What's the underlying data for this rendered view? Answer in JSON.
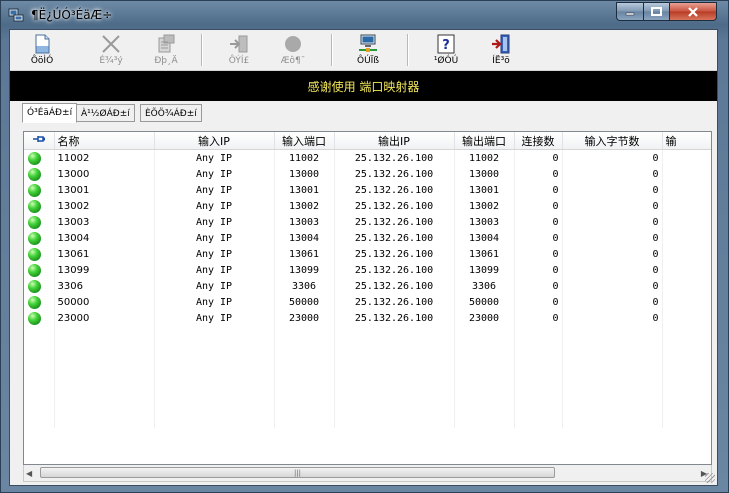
{
  "window": {
    "title": "¶Ë¿ÚÓ³ÉäÆ÷",
    "banner": "感谢使用 端口映射器"
  },
  "toolbar": [
    {
      "label": "ÔöÌÓ",
      "icon": "new-document-icon",
      "enabled": true
    },
    {
      "label": "É¾³ý",
      "icon": "delete-x-icon",
      "enabled": false
    },
    {
      "label": "Ðþ¸Ä",
      "icon": "edit-icon",
      "enabled": false
    },
    {
      "label": "ÔÝÍ£",
      "icon": "pause-icon",
      "enabled": false
    },
    {
      "label": "Æô¶¯",
      "icon": "start-circle-icon",
      "enabled": false
    },
    {
      "label": "ÔÚÏß",
      "icon": "network-computer-icon",
      "enabled": true
    },
    {
      "label": "¹ØÓÚ",
      "icon": "help-question-icon",
      "enabled": true
    },
    {
      "label": "ÍË³ö",
      "icon": "exit-door-icon",
      "enabled": true
    }
  ],
  "tabs": [
    {
      "label": "Ó³ÉäÁÐ±í",
      "active": true
    },
    {
      "label": "À¹½ØÁÐ±í",
      "active": false
    },
    {
      "label": "ÈÕÖ¾ÁÐ±í",
      "active": false
    }
  ],
  "table": {
    "columns": {
      "name": "名称",
      "in_ip": "输入IP",
      "in_port": "输入端口",
      "out_ip": "输出IP",
      "out_port": "输出端口",
      "connections": "连接数",
      "bytes_in": "输入字节数",
      "bytes_out": "输"
    },
    "rows": [
      {
        "name": "11002",
        "in_ip": "Any IP",
        "in_port": "11002",
        "out_ip": "25.132.26.100",
        "out_port": "11002",
        "connections": "0",
        "bytes_in": "0"
      },
      {
        "name": "13000",
        "in_ip": "Any IP",
        "in_port": "13000",
        "out_ip": "25.132.26.100",
        "out_port": "13000",
        "connections": "0",
        "bytes_in": "0"
      },
      {
        "name": "13001",
        "in_ip": "Any IP",
        "in_port": "13001",
        "out_ip": "25.132.26.100",
        "out_port": "13001",
        "connections": "0",
        "bytes_in": "0"
      },
      {
        "name": "13002",
        "in_ip": "Any IP",
        "in_port": "13002",
        "out_ip": "25.132.26.100",
        "out_port": "13002",
        "connections": "0",
        "bytes_in": "0"
      },
      {
        "name": "13003",
        "in_ip": "Any IP",
        "in_port": "13003",
        "out_ip": "25.132.26.100",
        "out_port": "13003",
        "connections": "0",
        "bytes_in": "0"
      },
      {
        "name": "13004",
        "in_ip": "Any IP",
        "in_port": "13004",
        "out_ip": "25.132.26.100",
        "out_port": "13004",
        "connections": "0",
        "bytes_in": "0"
      },
      {
        "name": "13061",
        "in_ip": "Any IP",
        "in_port": "13061",
        "out_ip": "25.132.26.100",
        "out_port": "13061",
        "connections": "0",
        "bytes_in": "0"
      },
      {
        "name": "13099",
        "in_ip": "Any IP",
        "in_port": "13099",
        "out_ip": "25.132.26.100",
        "out_port": "13099",
        "connections": "0",
        "bytes_in": "0"
      },
      {
        "name": "3306",
        "in_ip": "Any IP",
        "in_port": "3306",
        "out_ip": "25.132.26.100",
        "out_port": "3306",
        "connections": "0",
        "bytes_in": "0"
      },
      {
        "name": "50000",
        "in_ip": "Any IP",
        "in_port": "50000",
        "out_ip": "25.132.26.100",
        "out_port": "50000",
        "connections": "0",
        "bytes_in": "0"
      },
      {
        "name": "23000",
        "in_ip": "Any IP",
        "in_port": "23000",
        "out_ip": "25.132.26.100",
        "out_port": "23000",
        "connections": "0",
        "bytes_in": "0"
      }
    ]
  },
  "colors": {
    "banner_bg": "#000000",
    "banner_text": "#f2e85a",
    "status_active": "#1fbf2a"
  }
}
